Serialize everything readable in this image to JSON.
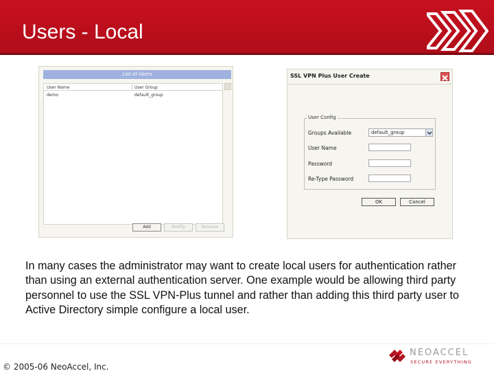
{
  "slide": {
    "title": "Users - Local",
    "body": "In many cases the administrator may want to create local users for authentication rather than using an external authentication server. One example would be allowing third party personnel to use the SSL VPN-Plus tunnel and rather than adding this third party user to Active Directory simple configure a local user."
  },
  "users_list": {
    "title": "List of Users",
    "columns": [
      "User Name",
      "User Group"
    ],
    "rows": [
      [
        "demo",
        "default_group"
      ]
    ],
    "buttons": {
      "add": "Add",
      "modify": "Modify",
      "remove": "Remove"
    }
  },
  "create_dialog": {
    "title": "SSL VPN Plus User Create",
    "group_legend": "User Config",
    "fields": {
      "groups_available": "Groups Available",
      "groups_selected": "default_group",
      "user_name": "User Name",
      "password": "Password",
      "retype_password": "Re-Type Password"
    },
    "buttons": {
      "ok": "OK",
      "cancel": "Cancel"
    }
  },
  "footer": {
    "copyright": "© 2005-06 NeoAccel, Inc.",
    "logo_name": "NEOACCEL",
    "logo_tagline": "SECURE EVERYTHING"
  },
  "colors": {
    "header_red": "#c8101f",
    "chevron": "#ffffff"
  },
  "icons": [
    "chevron-right-icon",
    "close-icon",
    "dropdown-arrow-icon",
    "neoaccel-logo"
  ]
}
